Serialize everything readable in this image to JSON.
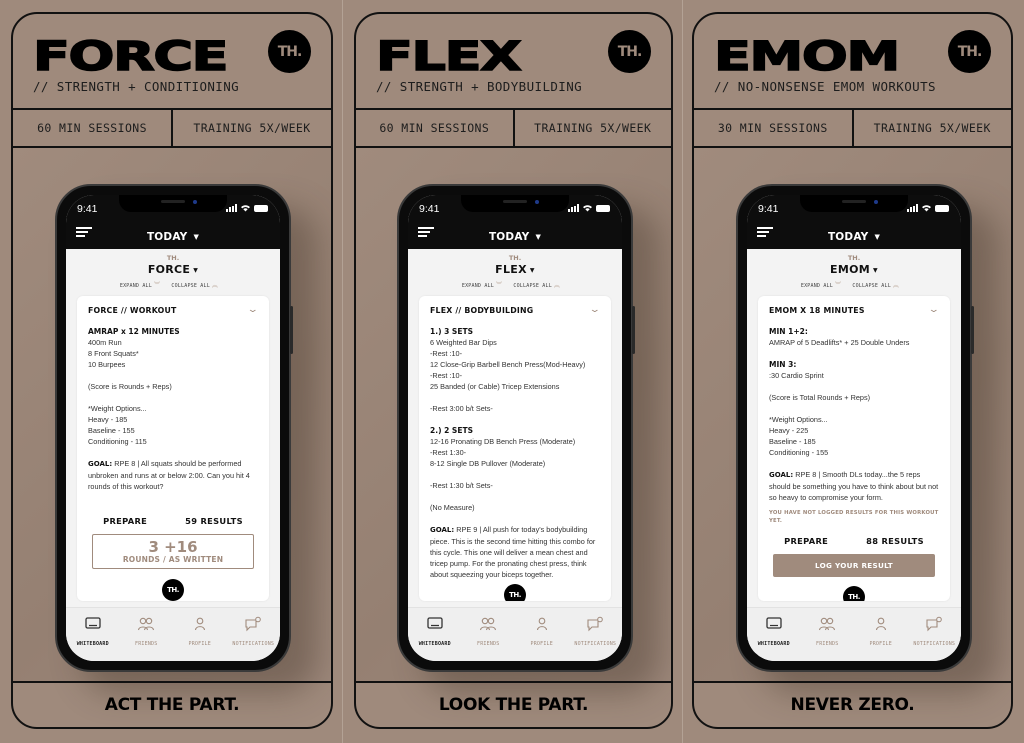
{
  "colors": {
    "background": "#a08b7d",
    "ink": "#111111",
    "accent": "#a08b7d",
    "screen": "#f3f3f3"
  },
  "panels": [
    {
      "title": "FORCE",
      "logo": "TH.",
      "subtitle": "// STRENGTH + CONDITIONING",
      "stats": [
        "60 MIN SESSIONS",
        "TRAINING 5X/WEEK"
      ],
      "tagline": "ACT THE PART.",
      "phone": {
        "time": "9:41",
        "header": "TODAY",
        "brand": "TH.",
        "program": "FORCE",
        "expand_all": "EXPAND ALL",
        "collapse_all": "COLLAPSE ALL",
        "card": {
          "title": "FORCE // WORKOUT",
          "lines": [
            {
              "text": "AMRAP x 12 MINUTES",
              "bold": true
            },
            {
              "text": "400m Run"
            },
            {
              "text": "8 Front Squats*"
            },
            {
              "text": "10 Burpees"
            },
            {
              "text": ""
            },
            {
              "text": "(Score is Rounds + Reps)"
            },
            {
              "text": ""
            },
            {
              "text": "*Weight Options..."
            },
            {
              "text": "Heavy - 185"
            },
            {
              "text": "Baseline - 155"
            },
            {
              "text": "Conditioning - 115"
            },
            {
              "text": ""
            }
          ],
          "goal_label": "GOAL:",
          "goal_text": "RPE 8 | All squats should be performed unbroken and runs at or below 2:00. Can you hit 4 rounds of this workout?",
          "prepare": "PREPARE",
          "results": "59 RESULTS",
          "score": "3 +16",
          "score_label": "ROUNDS / AS WRITTEN",
          "logo": "TH."
        },
        "tabs": [
          {
            "label": "WHITEBOARD",
            "icon": "whiteboard-icon",
            "active": true
          },
          {
            "label": "FRIENDS",
            "icon": "friends-icon",
            "active": false
          },
          {
            "label": "PROFILE",
            "icon": "profile-icon",
            "active": false
          },
          {
            "label": "NOTIFICATIONS",
            "icon": "notifications-icon",
            "active": false
          }
        ]
      }
    },
    {
      "title": "FLEX",
      "logo": "TH.",
      "subtitle": "// STRENGTH + BODYBUILDING",
      "stats": [
        "60 MIN SESSIONS",
        "TRAINING 5X/WEEK"
      ],
      "tagline": "LOOK THE PART.",
      "phone": {
        "time": "9:41",
        "header": "TODAY",
        "brand": "TH.",
        "program": "FLEX",
        "expand_all": "EXPAND ALL",
        "collapse_all": "COLLAPSE ALL",
        "card": {
          "title": "FLEX // BODYBUILDING",
          "lines": [
            {
              "text": "1.) 3 SETS",
              "bold": true
            },
            {
              "text": "6 Weighted Bar Dips"
            },
            {
              "text": "-Rest :10-"
            },
            {
              "text": "12 Close-Grip Barbell Bench Press(Mod-Heavy)"
            },
            {
              "text": "-Rest :10-"
            },
            {
              "text": "25 Banded (or Cable) Tricep Extensions"
            },
            {
              "text": ""
            },
            {
              "text": "-Rest 3:00 b/t Sets-"
            },
            {
              "text": ""
            },
            {
              "text": "2.) 2 SETS",
              "bold": true
            },
            {
              "text": "12-16 Pronating DB Bench Press (Moderate)"
            },
            {
              "text": "-Rest 1:30-"
            },
            {
              "text": "8-12 Single DB Pullover (Moderate)"
            },
            {
              "text": ""
            },
            {
              "text": "-Rest 1:30 b/t Sets-"
            },
            {
              "text": ""
            },
            {
              "text": "(No Measure)"
            },
            {
              "text": ""
            }
          ],
          "goal_label": "GOAL:",
          "goal_text": "RPE 9 | All push for today's bodybuilding piece. This is the second time hitting this combo for this cycle. This one will deliver a mean chest and tricep pump. For the pronating chest press, think about squeezing your biceps together.",
          "logo": "TH."
        },
        "tabs": [
          {
            "label": "WHITEBOARD",
            "icon": "whiteboard-icon",
            "active": true
          },
          {
            "label": "FRIENDS",
            "icon": "friends-icon",
            "active": false
          },
          {
            "label": "PROFILE",
            "icon": "profile-icon",
            "active": false
          },
          {
            "label": "NOTIFICATIONS",
            "icon": "notifications-icon",
            "active": false
          }
        ]
      }
    },
    {
      "title": "EMOM",
      "logo": "TH.",
      "subtitle": "// NO-NONSENSE EMOM WORKOUTS",
      "stats": [
        "30 MIN SESSIONS",
        "TRAINING 5X/WEEK"
      ],
      "tagline": "NEVER ZERO.",
      "phone": {
        "time": "9:41",
        "header": "TODAY",
        "brand": "TH.",
        "program": "EMOM",
        "expand_all": "EXPAND ALL",
        "collapse_all": "COLLAPSE ALL",
        "card": {
          "title": "EMOM X 18 MINUTES",
          "lines": [
            {
              "text": "MIN 1+2:",
              "bold": true
            },
            {
              "text": "AMRAP of 5 Deadlifts* + 25 Double Unders"
            },
            {
              "text": ""
            },
            {
              "text": "MIN 3:",
              "bold": true
            },
            {
              "text": ":30 Cardio Sprint"
            },
            {
              "text": ""
            },
            {
              "text": "(Score is Total Rounds + Reps)"
            },
            {
              "text": ""
            },
            {
              "text": "*Weight Options..."
            },
            {
              "text": "Heavy - 225"
            },
            {
              "text": "Baseline - 185"
            },
            {
              "text": "Conditioning - 155"
            },
            {
              "text": ""
            }
          ],
          "goal_label": "GOAL:",
          "goal_text": "RPE 8 | Smooth DLs today...the 5 reps should be something you have to think about but not so heavy to compromise your form.",
          "warning": "YOU HAVE NOT LOGGED RESULTS FOR THIS WORKOUT YET.",
          "prepare": "PREPARE",
          "results": "88 RESULTS",
          "log_button": "LOG YOUR RESULT",
          "logo": "TH."
        },
        "tabs": [
          {
            "label": "WHITEBOARD",
            "icon": "whiteboard-icon",
            "active": true
          },
          {
            "label": "FRIENDS",
            "icon": "friends-icon",
            "active": false
          },
          {
            "label": "PROFILE",
            "icon": "profile-icon",
            "active": false
          },
          {
            "label": "NOTIFICATIONS",
            "icon": "notifications-icon",
            "active": false
          }
        ]
      }
    }
  ]
}
